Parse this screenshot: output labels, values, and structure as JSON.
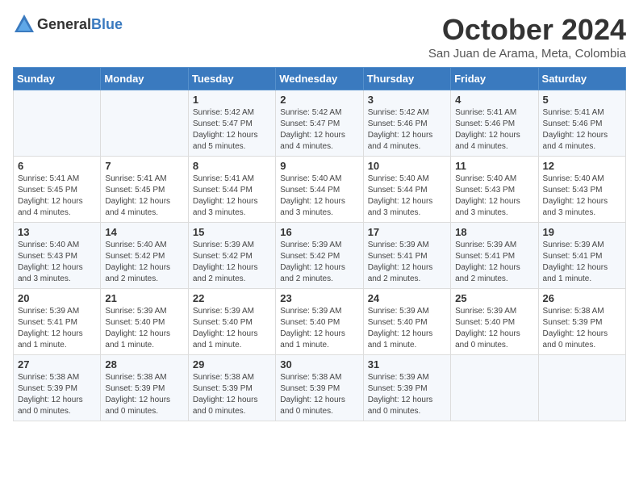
{
  "logo": {
    "general": "General",
    "blue": "Blue"
  },
  "header": {
    "month_year": "October 2024",
    "location": "San Juan de Arama, Meta, Colombia"
  },
  "weekdays": [
    "Sunday",
    "Monday",
    "Tuesday",
    "Wednesday",
    "Thursday",
    "Friday",
    "Saturday"
  ],
  "weeks": [
    [
      {
        "day": "",
        "sunrise": "",
        "sunset": "",
        "daylight": ""
      },
      {
        "day": "",
        "sunrise": "",
        "sunset": "",
        "daylight": ""
      },
      {
        "day": "1",
        "sunrise": "Sunrise: 5:42 AM",
        "sunset": "Sunset: 5:47 PM",
        "daylight": "Daylight: 12 hours and 5 minutes."
      },
      {
        "day": "2",
        "sunrise": "Sunrise: 5:42 AM",
        "sunset": "Sunset: 5:47 PM",
        "daylight": "Daylight: 12 hours and 4 minutes."
      },
      {
        "day": "3",
        "sunrise": "Sunrise: 5:42 AM",
        "sunset": "Sunset: 5:46 PM",
        "daylight": "Daylight: 12 hours and 4 minutes."
      },
      {
        "day": "4",
        "sunrise": "Sunrise: 5:41 AM",
        "sunset": "Sunset: 5:46 PM",
        "daylight": "Daylight: 12 hours and 4 minutes."
      },
      {
        "day": "5",
        "sunrise": "Sunrise: 5:41 AM",
        "sunset": "Sunset: 5:46 PM",
        "daylight": "Daylight: 12 hours and 4 minutes."
      }
    ],
    [
      {
        "day": "6",
        "sunrise": "Sunrise: 5:41 AM",
        "sunset": "Sunset: 5:45 PM",
        "daylight": "Daylight: 12 hours and 4 minutes."
      },
      {
        "day": "7",
        "sunrise": "Sunrise: 5:41 AM",
        "sunset": "Sunset: 5:45 PM",
        "daylight": "Daylight: 12 hours and 4 minutes."
      },
      {
        "day": "8",
        "sunrise": "Sunrise: 5:41 AM",
        "sunset": "Sunset: 5:44 PM",
        "daylight": "Daylight: 12 hours and 3 minutes."
      },
      {
        "day": "9",
        "sunrise": "Sunrise: 5:40 AM",
        "sunset": "Sunset: 5:44 PM",
        "daylight": "Daylight: 12 hours and 3 minutes."
      },
      {
        "day": "10",
        "sunrise": "Sunrise: 5:40 AM",
        "sunset": "Sunset: 5:44 PM",
        "daylight": "Daylight: 12 hours and 3 minutes."
      },
      {
        "day": "11",
        "sunrise": "Sunrise: 5:40 AM",
        "sunset": "Sunset: 5:43 PM",
        "daylight": "Daylight: 12 hours and 3 minutes."
      },
      {
        "day": "12",
        "sunrise": "Sunrise: 5:40 AM",
        "sunset": "Sunset: 5:43 PM",
        "daylight": "Daylight: 12 hours and 3 minutes."
      }
    ],
    [
      {
        "day": "13",
        "sunrise": "Sunrise: 5:40 AM",
        "sunset": "Sunset: 5:43 PM",
        "daylight": "Daylight: 12 hours and 3 minutes."
      },
      {
        "day": "14",
        "sunrise": "Sunrise: 5:40 AM",
        "sunset": "Sunset: 5:42 PM",
        "daylight": "Daylight: 12 hours and 2 minutes."
      },
      {
        "day": "15",
        "sunrise": "Sunrise: 5:39 AM",
        "sunset": "Sunset: 5:42 PM",
        "daylight": "Daylight: 12 hours and 2 minutes."
      },
      {
        "day": "16",
        "sunrise": "Sunrise: 5:39 AM",
        "sunset": "Sunset: 5:42 PM",
        "daylight": "Daylight: 12 hours and 2 minutes."
      },
      {
        "day": "17",
        "sunrise": "Sunrise: 5:39 AM",
        "sunset": "Sunset: 5:41 PM",
        "daylight": "Daylight: 12 hours and 2 minutes."
      },
      {
        "day": "18",
        "sunrise": "Sunrise: 5:39 AM",
        "sunset": "Sunset: 5:41 PM",
        "daylight": "Daylight: 12 hours and 2 minutes."
      },
      {
        "day": "19",
        "sunrise": "Sunrise: 5:39 AM",
        "sunset": "Sunset: 5:41 PM",
        "daylight": "Daylight: 12 hours and 1 minute."
      }
    ],
    [
      {
        "day": "20",
        "sunrise": "Sunrise: 5:39 AM",
        "sunset": "Sunset: 5:41 PM",
        "daylight": "Daylight: 12 hours and 1 minute."
      },
      {
        "day": "21",
        "sunrise": "Sunrise: 5:39 AM",
        "sunset": "Sunset: 5:40 PM",
        "daylight": "Daylight: 12 hours and 1 minute."
      },
      {
        "day": "22",
        "sunrise": "Sunrise: 5:39 AM",
        "sunset": "Sunset: 5:40 PM",
        "daylight": "Daylight: 12 hours and 1 minute."
      },
      {
        "day": "23",
        "sunrise": "Sunrise: 5:39 AM",
        "sunset": "Sunset: 5:40 PM",
        "daylight": "Daylight: 12 hours and 1 minute."
      },
      {
        "day": "24",
        "sunrise": "Sunrise: 5:39 AM",
        "sunset": "Sunset: 5:40 PM",
        "daylight": "Daylight: 12 hours and 1 minute."
      },
      {
        "day": "25",
        "sunrise": "Sunrise: 5:39 AM",
        "sunset": "Sunset: 5:40 PM",
        "daylight": "Daylight: 12 hours and 0 minutes."
      },
      {
        "day": "26",
        "sunrise": "Sunrise: 5:38 AM",
        "sunset": "Sunset: 5:39 PM",
        "daylight": "Daylight: 12 hours and 0 minutes."
      }
    ],
    [
      {
        "day": "27",
        "sunrise": "Sunrise: 5:38 AM",
        "sunset": "Sunset: 5:39 PM",
        "daylight": "Daylight: 12 hours and 0 minutes."
      },
      {
        "day": "28",
        "sunrise": "Sunrise: 5:38 AM",
        "sunset": "Sunset: 5:39 PM",
        "daylight": "Daylight: 12 hours and 0 minutes."
      },
      {
        "day": "29",
        "sunrise": "Sunrise: 5:38 AM",
        "sunset": "Sunset: 5:39 PM",
        "daylight": "Daylight: 12 hours and 0 minutes."
      },
      {
        "day": "30",
        "sunrise": "Sunrise: 5:38 AM",
        "sunset": "Sunset: 5:39 PM",
        "daylight": "Daylight: 12 hours and 0 minutes."
      },
      {
        "day": "31",
        "sunrise": "Sunrise: 5:39 AM",
        "sunset": "Sunset: 5:39 PM",
        "daylight": "Daylight: 12 hours and 0 minutes."
      },
      {
        "day": "",
        "sunrise": "",
        "sunset": "",
        "daylight": ""
      },
      {
        "day": "",
        "sunrise": "",
        "sunset": "",
        "daylight": ""
      }
    ]
  ]
}
